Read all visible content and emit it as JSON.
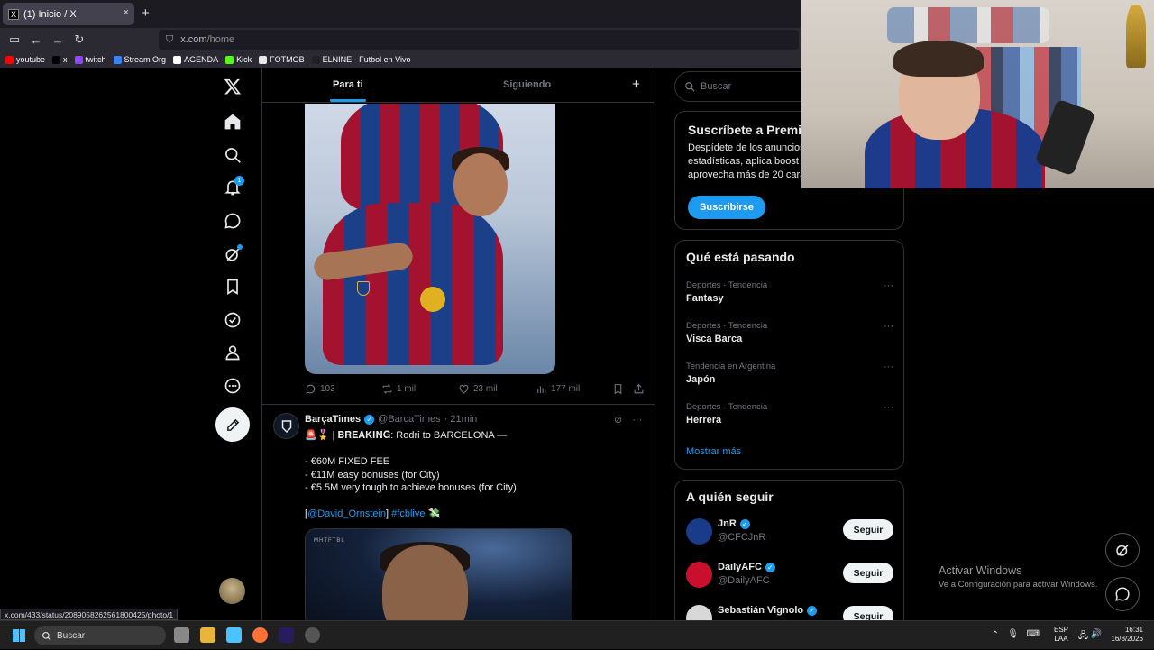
{
  "browser": {
    "tab_title": "(1) Inicio / X",
    "tab_close": "×",
    "new_tab": "+",
    "url_host": "x.com",
    "url_path": "/home",
    "status_url": "x.com/433/status/2089058262561800425/photo/1",
    "bookmarks": [
      {
        "label": "youtube",
        "color": "#ff0000"
      },
      {
        "label": "x",
        "color": "#000000"
      },
      {
        "label": "twitch",
        "color": "#9146ff"
      },
      {
        "label": "Stream Org",
        "color": "#3b82f6"
      },
      {
        "label": "AGENDA",
        "color": "#ffffff"
      },
      {
        "label": "Kick",
        "color": "#53fc18"
      },
      {
        "label": "FOTMOB",
        "color": "#e8e8e8"
      },
      {
        "label": "ELNINE - Futbol en Vivo",
        "color": "#222222"
      }
    ]
  },
  "feed": {
    "tab_for_you": "Para ti",
    "tab_following": "Siguiendo",
    "add": "+",
    "post1_stats": {
      "replies": "103",
      "reposts": "1 mil",
      "likes": "23 mil",
      "views": "177 mil"
    },
    "post2": {
      "name": "BarçaTimes",
      "handle": "@BarcaTimes",
      "time": "· 21min",
      "line1": "🚨🎖️ | 𝐁𝐑𝐄𝐀𝐊𝐈𝐍𝐆: Rodri to BARCELONA —",
      "line2": "- €60M FIXED FEE",
      "line3": "- €11M easy bonuses (for City)",
      "line4": "- €5.5M very tough to achieve bonuses (for City)",
      "link_open": "[",
      "mention": "@David_Ornstein",
      "link_close": "]",
      "hashtag": "#fcblive",
      "emoji": "💸",
      "image_brand": "MHTFTBL"
    }
  },
  "sidebar": {
    "search_placeholder": "Buscar",
    "premium_title": "Suscríbete a Premium",
    "premium_text": "Despídete de los anuncios, ve\nestadísticas, aplica boost a tus\naprovecha más de 20 características",
    "premium_button": "Suscribirse",
    "trends_title": "Qué está pasando",
    "trends": [
      {
        "category": "Deportes · Tendencia",
        "title": "Fantasy"
      },
      {
        "category": "Deportes · Tendencia",
        "title": "Visca Barca"
      },
      {
        "category": "Tendencia en Argentina",
        "title": "Japón"
      },
      {
        "category": "Deportes · Tendencia",
        "title": "Herrera"
      }
    ],
    "show_more": "Mostrar más",
    "follow_title": "A quién seguir",
    "follow": [
      {
        "name": "JnR",
        "handle": "@CFCJnR",
        "button": "Seguir",
        "color": "#1a3a8a"
      },
      {
        "name": "DailyAFC",
        "handle": "@DailyAFC",
        "button": "Seguir",
        "color": "#c8102e"
      },
      {
        "name": "Sebastián Vignolo",
        "handle": "",
        "button": "Seguir",
        "color": "#d8d8d8"
      }
    ]
  },
  "nav": {
    "notification_count": "1"
  },
  "windows": {
    "activate_title": "Activar Windows",
    "activate_sub": "Ve a Configuración para activar Windows.",
    "search": "Buscar",
    "lang1": "ESP",
    "lang2": "LAA",
    "time": "16:31",
    "date": "16/8/2026"
  },
  "colors": {
    "accent": "#1d9bf0",
    "background": "#000000",
    "border": "#2f3336"
  }
}
